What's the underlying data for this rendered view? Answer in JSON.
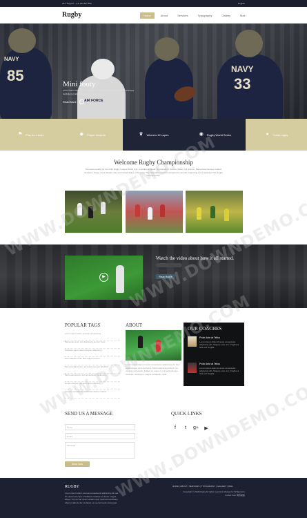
{
  "topbar": {
    "support": "24/7 Support : (+1) 234 567 890",
    "language": "English"
  },
  "header": {
    "logo": "Rugby",
    "nav": [
      "Home",
      "About",
      "Services",
      "Typography",
      "Gallery",
      "Mail"
    ],
    "active_nav": "Home"
  },
  "hero": {
    "title": "Mini footy",
    "text": "Lorem ipsum dolor sit amet consectetur adipiscing elit sed do eiusmod tempor incididunt ut labore et dolore magna aliqua.",
    "more": "Read More",
    "dots": 3,
    "active_dot": 1,
    "jersey_numbers": [
      "85",
      "33"
    ],
    "jersey_text": [
      "NAVY",
      "NAVY",
      "AIR FORCE"
    ]
  },
  "features": [
    {
      "label": "Play as a team",
      "icon": "flag-icon",
      "style": "light"
    },
    {
      "label": "Player rewards",
      "icon": "tag-icon",
      "style": "light"
    },
    {
      "label": "Winners 12 cupes",
      "icon": "trophy-icon",
      "style": "dark"
    },
    {
      "label": "Rugby World Series",
      "icon": "globe-icon",
      "style": "dark"
    },
    {
      "label": "Today rugby",
      "icon": "rugby-ball-icon",
      "style": "light"
    }
  ],
  "welcome": {
    "title": "Welcome Rugby Championship",
    "text": "The teams qualify for the 2019 Rugby League World Cup: Australia, England, New Zealand, Samoa, Wales, Fiji, France, Papua New Guinea, Ireland, Scotland, Tonga, Cook Islands, Italy and United States of America. The Federation award is accepted for Annual Organizing and is awarded The Rugby Championship."
  },
  "video": {
    "title": "Watch the video about how it all started.",
    "button": "Read More"
  },
  "popular_tags": {
    "title": "POPULAR TAGS",
    "items": [
      "Lorem ipsum dolor sit amet consectetur",
      "Maecenas enim orci adipiscing tempor vitae",
      "Praesent eget metus congue, adipiscing",
      "Nam dapibus enim quis augue tempor",
      "Sed convallis lorem nec lectus semper tincidunt",
      "Morbi elementum nisl vel tincidunt vestibulum",
      "Donec congue nisl sed magna ultrices",
      "Aenean convallis et sollicitudin dictum mauris"
    ]
  },
  "about": {
    "title": "ABOUT",
    "text": "Lorem ipsum dolor sit amet consectetur adipiscing elit. Sed pellentesque urna sed lacus. Morbi adipiscing felis at nisl volutpat consequat. Nullam ac augue in nisl pellentesque vehicula. Vestibulum magna ut aliquam nulla."
  },
  "coaches": {
    "title": "OUR COACHES",
    "items": [
      {
        "name": "Proin Ante at Tellus",
        "text": "Lorem ipsum dolor sit amet consectetur adipiscing elit. Aliquam eros orci, fringilla ut felis sed fringilla."
      },
      {
        "name": "Proin Ante at Tellus",
        "text": "Lorem ipsum dolor sit amet consectetur adipiscing elit. Aliquam eros orci, fringilla ut felis sed fringilla."
      }
    ]
  },
  "message": {
    "title": "SEND US A MESSAGE",
    "name_placeholder": "Name",
    "email_placeholder": "Email",
    "message_placeholder": "Message",
    "send": "Send Now"
  },
  "quick_links": {
    "title": "QUICK LINKS",
    "social": [
      {
        "name": "facebook-icon",
        "glyph": "f"
      },
      {
        "name": "twitter-icon",
        "glyph": "t"
      },
      {
        "name": "google-plus-icon",
        "glyph": "g+"
      },
      {
        "name": "youtube-icon",
        "glyph": "▶"
      }
    ]
  },
  "footer": {
    "logo": "RUGBY",
    "text": "Lorem ipsum dolor sit amet consectetur adipiscing elit sed do eiusmod tempor incididunt ut labore et dolore magna aliqua. Ut enim ad minim veniam quis nostrud exercitation ullamco laboris nisi ut aliquip ex ea commodo consequat.",
    "nav": "HOME | ABOUT | SERVICES | TYPOGRAPHY | GALLERY | MAIL",
    "copyright": "Copyright © 2016 Rugby All rights reserved | Design by W3layouts | Collect from 网页模板"
  },
  "watermark": "WWW.DOWNDEMO.COM",
  "colors": {
    "gold": "#c9bd8b",
    "navy": "#1f2436",
    "footer": "#1c2030",
    "topbar": "#1b1f2e"
  }
}
